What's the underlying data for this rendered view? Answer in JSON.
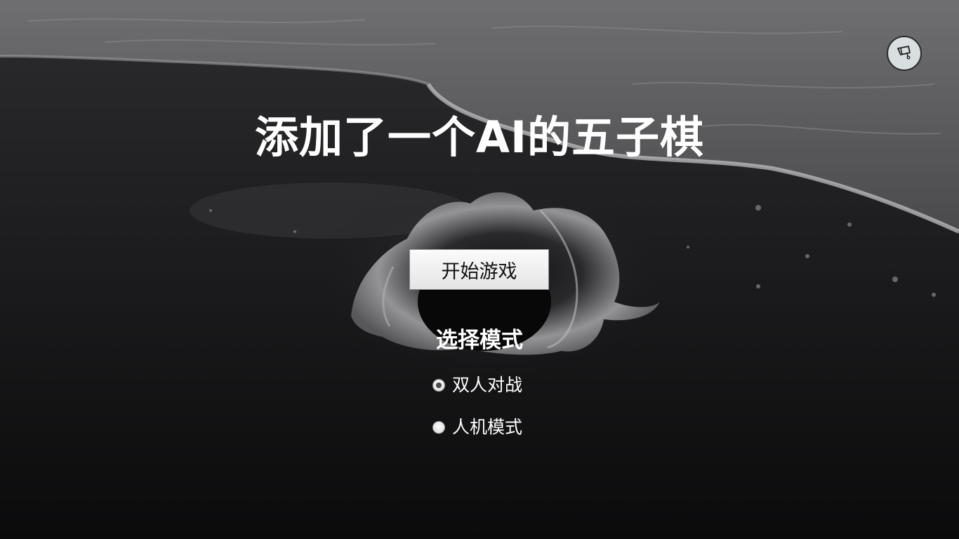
{
  "app": {
    "title": "添加了一个AI的五子棋"
  },
  "corner_button": {
    "icon": "flag-icon"
  },
  "start": {
    "label": "开始游戏"
  },
  "mode": {
    "heading": "选择模式",
    "options": [
      {
        "label": "双人对战",
        "selected": true
      },
      {
        "label": "人机模式",
        "selected": false
      }
    ]
  },
  "colors": {
    "title": "#ffffff",
    "button_face": "#f0f0f0",
    "background": "#0d0d0e"
  }
}
